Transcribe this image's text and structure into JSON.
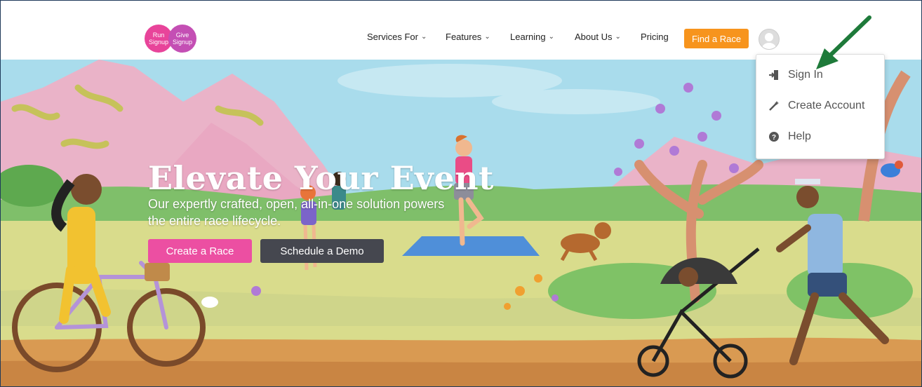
{
  "logo": {
    "left_word_top": "Run",
    "left_word_bottom": "Signup",
    "right_word_top": "Give",
    "right_word_bottom": "Signup"
  },
  "nav": {
    "items": [
      {
        "label": "Services For",
        "has_dropdown": true
      },
      {
        "label": "Features",
        "has_dropdown": true
      },
      {
        "label": "Learning",
        "has_dropdown": true
      },
      {
        "label": "About Us",
        "has_dropdown": true
      },
      {
        "label": "Pricing",
        "has_dropdown": false
      }
    ],
    "find_race_label": "Find a Race",
    "chevron": "⌄"
  },
  "hero": {
    "title": "Elevate Your Event",
    "subtitle": "Our expertly crafted, open, all-in-one solution powers the entire race lifecycle.",
    "create_label": "Create a Race",
    "demo_label": "Schedule a Demo"
  },
  "account_menu": {
    "items": [
      {
        "label": "Sign In",
        "icon": "sign-in-icon"
      },
      {
        "label": "Create Account",
        "icon": "magic-wand-icon"
      },
      {
        "label": "Help",
        "icon": "question-circle-icon"
      }
    ]
  },
  "colors": {
    "accent_orange": "#f7941d",
    "accent_pink": "#ec4fa2",
    "dark_button": "#45474f",
    "annotation_arrow": "#1e7a3a"
  }
}
